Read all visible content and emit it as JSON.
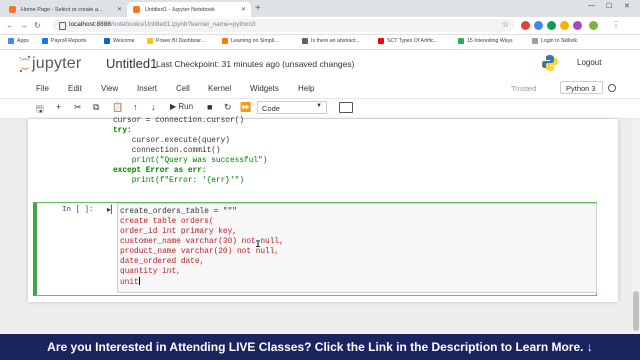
{
  "browser": {
    "tabs": [
      {
        "title": "Home Page - Select or create a...",
        "active": false
      },
      {
        "title": "Untitled1 - Jupyter Notebook",
        "active": true
      }
    ],
    "new_tab": "+",
    "url_host": "localhost:8888",
    "url_path": "/notebooks/Untitled1.ipynb?kernel_name=python3",
    "window_controls": {
      "minimize": "—",
      "maximize": "☐",
      "close": "✕"
    },
    "bookmarks": [
      {
        "label": "Apps",
        "color": "#4285f4"
      },
      {
        "label": "Payroll Reports",
        "color": "#1a73e8"
      },
      {
        "label": "Welcome",
        "color": "#0a66c2"
      },
      {
        "label": "Power BI Dashboar...",
        "color": "#f2c811"
      },
      {
        "label": "Learning on Simpli...",
        "color": "#f57c00"
      },
      {
        "label": "Is there an abstract...",
        "color": "#5f6368"
      },
      {
        "label": "SCT Types Of Artific...",
        "color": "#ff0000"
      },
      {
        "label": "15 Interesting Ways",
        "color": "#34a853"
      },
      {
        "label": "Login to Skillstk",
        "color": "#9e9e9e"
      }
    ]
  },
  "jupyter": {
    "logo_text": "jupyter",
    "notebook_name": "Untitled1",
    "checkpoint": "Last Checkpoint: 31 minutes ago  (unsaved changes)",
    "logout": "Logout",
    "menu": [
      "File",
      "Edit",
      "View",
      "Insert",
      "Cell",
      "Kernel",
      "Widgets",
      "Help"
    ],
    "trusted": "Trusted",
    "kernel": "Python 3",
    "toolbar": {
      "run_label": "Run",
      "cell_type": "Code"
    }
  },
  "cells": {
    "previous_lines": [
      "cursor = connection.cursor()",
      "try:",
      "    cursor.execute(query)",
      "    connection.commit()",
      "    print(\"Query was successful\")",
      "except Error as err:",
      "    print(f\"Error: '{err}'\")"
    ],
    "current_prompt": "In [ ]:",
    "current_lines": [
      "create_orders_table = \"\"\"",
      "create table orders(",
      "order_id int primary key,",
      "customer_name varchar(30) not null,",
      "product_name varchar(20) not null,",
      "date_ordered date,",
      "quantity int,",
      "unit"
    ]
  },
  "banner": {
    "text": "Are you Interested in Attending LIVE Classes? Click the Link in the Description to Learn More. ↓"
  },
  "colors": {
    "banner_bg": "#1a2560",
    "jupyter_orange": "#f37626",
    "active_cell_border": "#42a548"
  }
}
